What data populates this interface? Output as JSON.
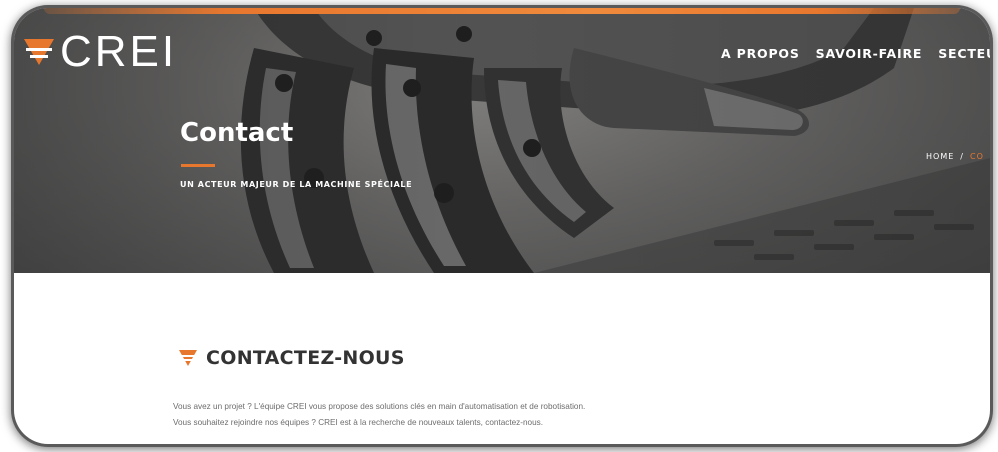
{
  "brand": {
    "logo_text": "CREI",
    "accent_color": "#e8772e"
  },
  "nav": {
    "items": [
      "A PROPOS",
      "SAVOIR-FAIRE",
      "SECTEURS"
    ]
  },
  "hero": {
    "title": "Contact",
    "tagline": "UN ACTEUR MAJEUR DE LA MACHINE SPÉCIALE",
    "breadcrumb": {
      "home": "HOME",
      "separator": "/",
      "current": "CO"
    }
  },
  "section": {
    "heading": "CONTACTEZ-NOUS",
    "lines": [
      "Vous avez un projet ? L'équipe CREI vous propose des solutions clés en main d'automatisation et de robotisation.",
      "Vous souhaitez rejoindre nos équipes ? CREI est à la recherche de nouveaux talents, contactez-nous."
    ]
  },
  "icons": {
    "logo": "crei-chevron-logo-icon",
    "heading": "orange-chevron-icon"
  }
}
